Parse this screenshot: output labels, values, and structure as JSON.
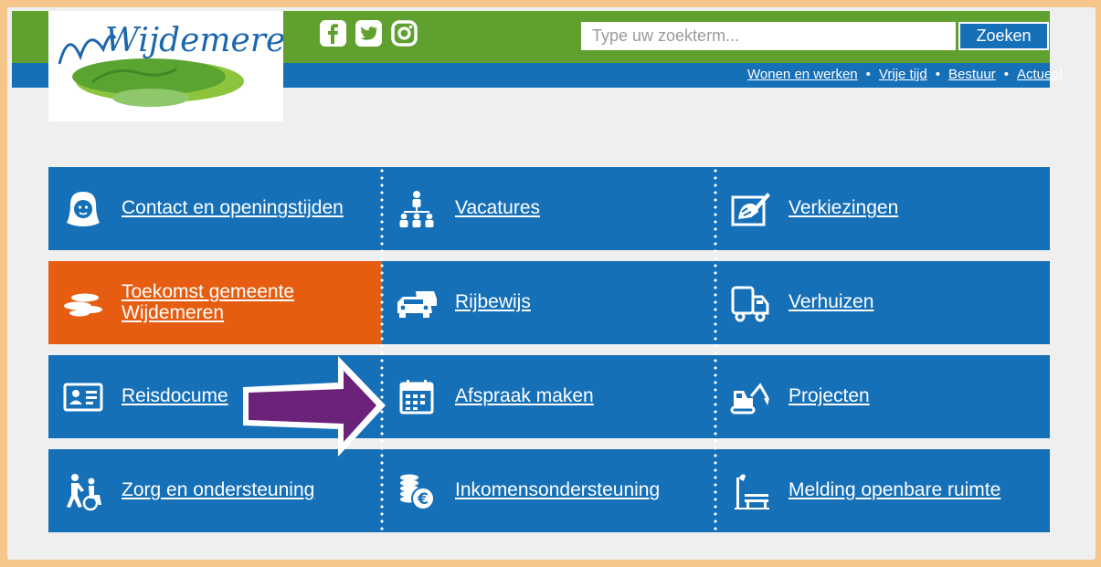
{
  "header": {
    "logo_text": "Wijdemeren",
    "social": [
      {
        "icon": "facebook-icon"
      },
      {
        "icon": "twitter-icon"
      },
      {
        "icon": "instagram-icon"
      }
    ],
    "search": {
      "placeholder": "Type uw zoekterm...",
      "value": "",
      "button_label": "Zoeken"
    },
    "nav": {
      "items": [
        "Wonen en werken",
        "Vrije tijd",
        "Bestuur",
        "Actueel"
      ],
      "separator": "•"
    }
  },
  "tiles": [
    {
      "label": "Contact en openingstijden",
      "icon": "woman-face-icon"
    },
    {
      "label": "Vacatures",
      "icon": "people-network-icon"
    },
    {
      "label": "Verkiezingen",
      "icon": "ballot-vote-icon"
    },
    {
      "label": "Toekomst gemeente Wijdemeren",
      "icon": "lily-pads-icon"
    },
    {
      "label": "Rijbewijs",
      "icon": "cars-icon"
    },
    {
      "label": "Verhuizen",
      "icon": "moving-truck-icon"
    },
    {
      "label": "Reisdocumenten",
      "label_visible": "Reisdocume",
      "icon": "id-card-icon"
    },
    {
      "label": "Afspraak maken",
      "icon": "calendar-icon"
    },
    {
      "label": "Projecten",
      "icon": "excavator-icon"
    },
    {
      "label": "Zorg en ondersteuning",
      "icon": "care-icon"
    },
    {
      "label": "Inkomensondersteuning",
      "icon": "coins-euro-icon"
    },
    {
      "label": "Melding openbare ruimte",
      "icon": "street-bench-icon"
    }
  ],
  "colors": {
    "page_border": "#f5c689",
    "top_bar_green": "#5fa02e",
    "brand_blue": "#1670b8",
    "tile_orange": "#e65d12",
    "annotation_arrow": "#6b2379"
  }
}
